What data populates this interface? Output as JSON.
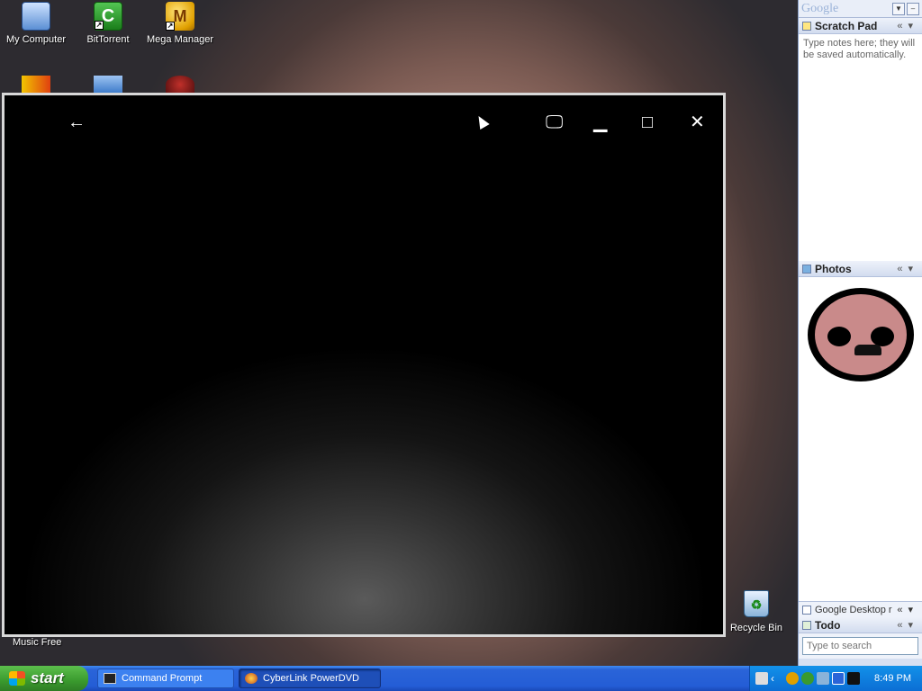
{
  "desktop": {
    "icons": [
      {
        "label": "My Computer"
      },
      {
        "label": "BitTorrent"
      },
      {
        "label": "Mega Manager"
      }
    ],
    "music_free_label": "Music Free",
    "recycle_bin_label": "Recycle Bin"
  },
  "player": {
    "back_icon": "←",
    "monitor_icon": "🖵",
    "minimize_icon": "▁",
    "maximize_icon": "□",
    "close_icon": "✕"
  },
  "sidebar": {
    "logo": "Google",
    "scratch_pad": {
      "title": "Scratch Pad",
      "body": "Type notes here; they will be saved automatically."
    },
    "photos": {
      "title": "Photos"
    },
    "google_desktop": {
      "title": "Google Desktop r"
    },
    "todo": {
      "title": "Todo"
    },
    "search_placeholder": "Type to search"
  },
  "taskbar": {
    "start_label": "start",
    "tasks": [
      {
        "label": "Command Prompt"
      },
      {
        "label": "CyberLink PowerDVD"
      }
    ],
    "clock": "8:49 PM"
  }
}
